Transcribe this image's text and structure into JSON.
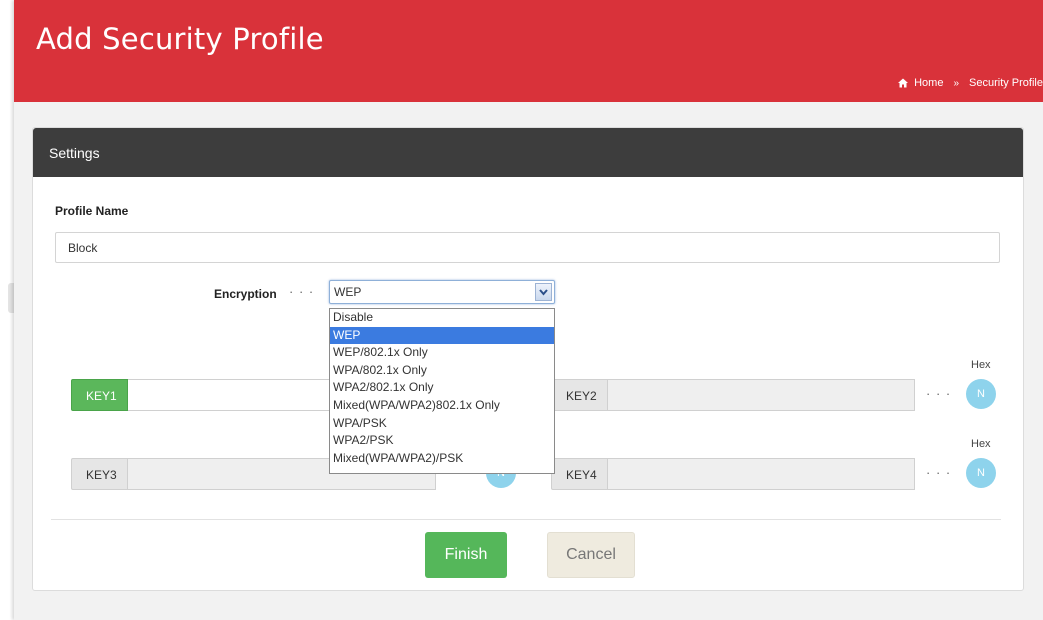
{
  "header": {
    "title": "Add Security Profile",
    "breadcrumb": {
      "home": "Home",
      "separator": "»",
      "current": "Security Profile"
    }
  },
  "panel": {
    "title": "Settings"
  },
  "profile_name": {
    "label": "Profile Name",
    "value": "Block"
  },
  "encryption": {
    "label": "Encryption",
    "dots": "· · ·",
    "selected": "WEP",
    "options": [
      "Disable",
      "WEP",
      "WEP/802.1x Only",
      "WPA/802.1x Only",
      "WPA2/802.1x Only",
      "Mixed(WPA/WPA2)802.1x Only",
      "WPA/PSK",
      "WPA2/PSK",
      "Mixed(WPA/WPA2)/PSK"
    ]
  },
  "keys": {
    "key1": {
      "label": "KEY1",
      "value": ""
    },
    "key2": {
      "label": "KEY2",
      "value": "",
      "hex_label": "Hex",
      "toggle": "N"
    },
    "key3": {
      "label": "KEY3",
      "value": "",
      "toggle": "N"
    },
    "key4": {
      "label": "KEY4",
      "value": "",
      "hex_label": "Hex",
      "toggle": "N"
    },
    "dots": "· · ·"
  },
  "buttons": {
    "finish": "Finish",
    "cancel": "Cancel"
  },
  "colors": {
    "header_bg": "#d9323a",
    "panel_head_bg": "#3d3d3d",
    "finish_bg": "#55b75a",
    "key_active": "#5bb75b",
    "hex_toggle": "#8ed3ec",
    "dropdown_selected": "#3b7be0"
  }
}
